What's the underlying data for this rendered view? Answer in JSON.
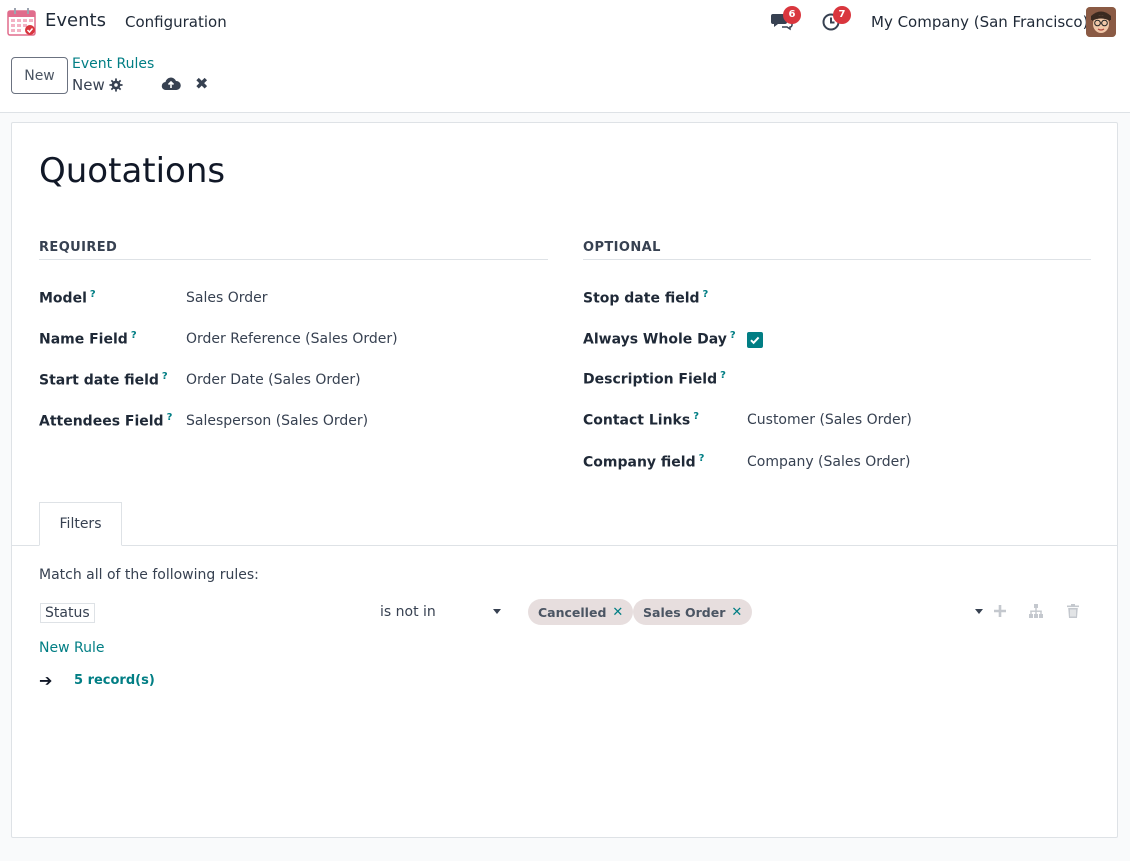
{
  "navbar": {
    "app_name": "Events",
    "menu_configuration": "Configuration",
    "messages_count": "6",
    "activities_count": "7",
    "company": "My Company (San Francisco)"
  },
  "control_panel": {
    "new_button": "New",
    "breadcrumb_parent": "Event Rules",
    "breadcrumb_current": "New"
  },
  "form": {
    "title": "Quotations",
    "required": {
      "heading": "REQUIRED",
      "fields": [
        {
          "label": "Model",
          "value": "Sales Order"
        },
        {
          "label": "Name Field",
          "value": "Order Reference (Sales Order)"
        },
        {
          "label": "Start date field",
          "value": "Order Date (Sales Order)"
        },
        {
          "label": "Attendees Field",
          "value": "Salesperson (Sales Order)"
        }
      ]
    },
    "optional": {
      "heading": "OPTIONAL",
      "fields": [
        {
          "label": "Stop date field",
          "value": ""
        },
        {
          "label": "Always Whole Day",
          "value": ""
        },
        {
          "label": "Description Field",
          "value": ""
        },
        {
          "label": "Contact Links",
          "value": "Customer (Sales Order)"
        },
        {
          "label": "Company field",
          "value": "Company (Sales Order)"
        }
      ],
      "always_whole_day_checked": true
    },
    "help_mark": "?"
  },
  "filters": {
    "tab_label": "Filters",
    "match_text": "Match all of the following rules:",
    "rule": {
      "field": "Status",
      "operator": "is not in",
      "tags": [
        "Cancelled",
        "Sales Order"
      ]
    },
    "new_rule": "New Rule",
    "records": "5 record(s)"
  },
  "colors": {
    "accent": "#017e84",
    "badge": "#d9363e",
    "tag_bg": "#e7dede"
  }
}
